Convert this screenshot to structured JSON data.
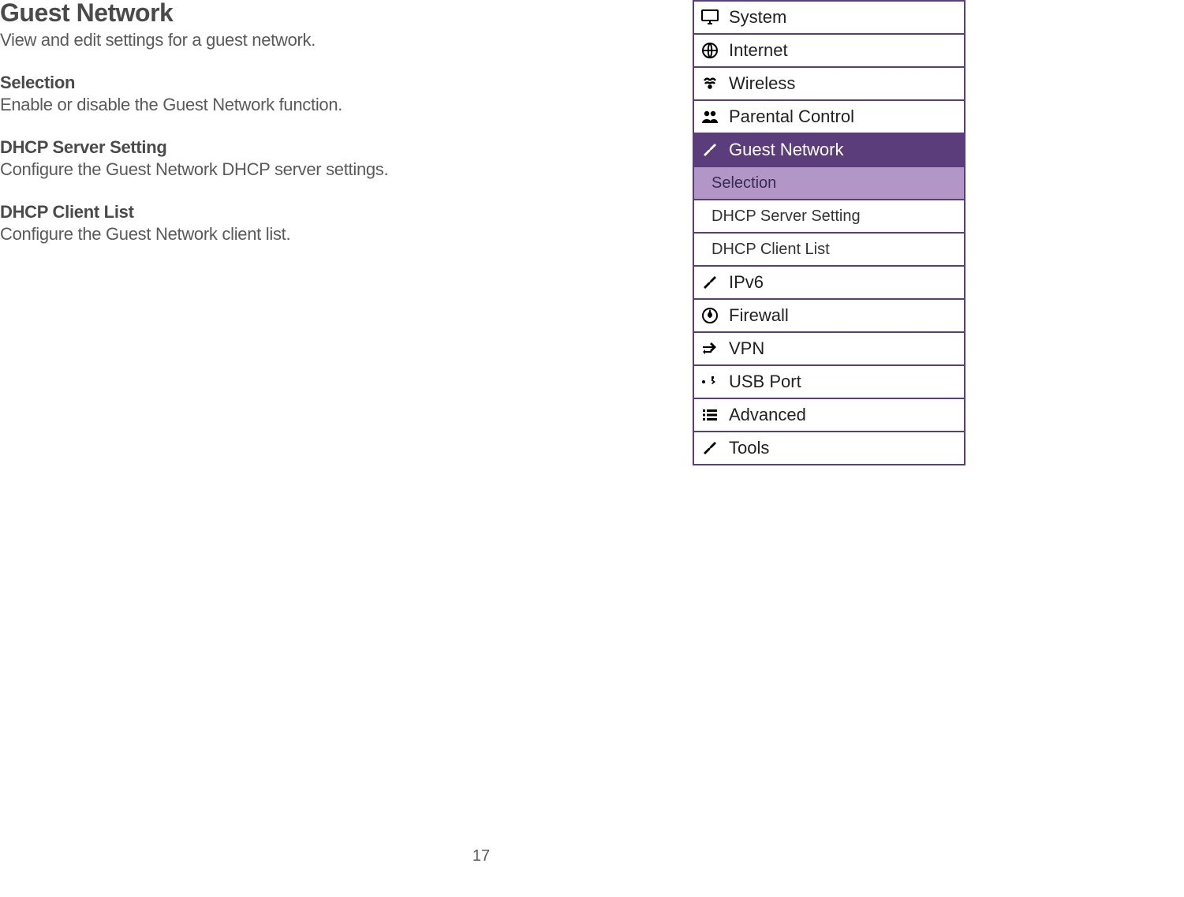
{
  "page": {
    "title": "Guest Network",
    "desc": "View and edit settings for a guest network.",
    "sections": [
      {
        "title": "Selection",
        "desc": "Enable or disable the Guest Network function."
      },
      {
        "title": "DHCP Server Setting",
        "desc": "Configure the Guest Network DHCP server settings."
      },
      {
        "title": "DHCP Client List",
        "desc": "Configure the Guest Network client list."
      }
    ],
    "number": "17"
  },
  "nav": {
    "items": [
      {
        "label": "System",
        "icon": "monitor"
      },
      {
        "label": "Internet",
        "icon": "globe"
      },
      {
        "label": "Wireless",
        "icon": "signal"
      },
      {
        "label": "Parental Control",
        "icon": "users"
      },
      {
        "label": "Guest Network",
        "icon": "tools",
        "active": true,
        "subs": [
          {
            "label": "Selection",
            "selected": true
          },
          {
            "label": "DHCP Server Setting"
          },
          {
            "label": "DHCP Client List"
          }
        ]
      },
      {
        "label": "IPv6",
        "icon": "tools"
      },
      {
        "label": "Firewall",
        "icon": "fire"
      },
      {
        "label": "VPN",
        "icon": "arrows"
      },
      {
        "label": "USB Port",
        "icon": "usb"
      },
      {
        "label": "Advanced",
        "icon": "list"
      },
      {
        "label": "Tools",
        "icon": "tools"
      }
    ]
  }
}
